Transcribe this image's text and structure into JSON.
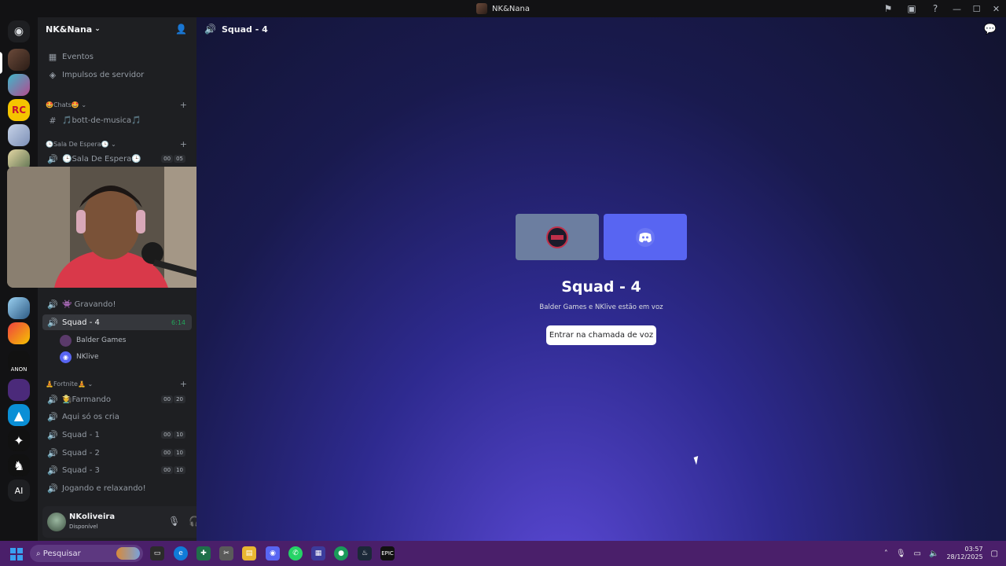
{
  "window": {
    "title": "NK&Nana",
    "minimize": "—",
    "maximize": "☐",
    "close": "✕"
  },
  "server": {
    "name": "NK&Nana"
  },
  "nav": [
    {
      "label": "Eventos",
      "icon": "calendar-icon"
    },
    {
      "label": "Impulsos de servidor",
      "icon": "boost-icon"
    }
  ],
  "categories": {
    "chats": "🤩Chats🤩",
    "espera": "🕒Sala De Espera🕒",
    "fortnite": "🧘Fortnite🧘"
  },
  "channels": {
    "bott": "🎵bott-de-musica🎵",
    "espera": "🕒Sala De Espera🕒",
    "gravando": "👾 Gravando!",
    "squad4": "Squad - 4",
    "squad4_time": "6:14",
    "farmando": "🧑‍🌾Farmando",
    "cria": "Aqui só os cria",
    "squad1": "Squad - 1",
    "squad2": "Squad - 2",
    "squad3": "Squad - 3",
    "jogando": "Jogando e relaxando!"
  },
  "counts": {
    "espera": [
      "00",
      "05"
    ],
    "farmando": [
      "00",
      "20"
    ],
    "squad1": [
      "00",
      "10"
    ],
    "squad2": [
      "00",
      "10"
    ],
    "squad3": [
      "00",
      "10"
    ]
  },
  "members": [
    "Balder Games",
    "NKlive"
  ],
  "user": {
    "name": "NKoliveira",
    "status": "Disponível"
  },
  "main": {
    "header": "Squad - 4",
    "title": "Squad - 4",
    "subtitle": "Balder Games e NKlive estão em voz",
    "join": "Entrar na chamada de voz"
  },
  "taskbar": {
    "search_placeholder": "Pesquisar",
    "time": "03:57",
    "date": "28/12/2025"
  },
  "guild_sidebar": {
    "ai_label": "AI"
  },
  "colors": {
    "accent": "#5865f2",
    "online": "#23a55a",
    "taskbar": "#4a1f6a"
  }
}
